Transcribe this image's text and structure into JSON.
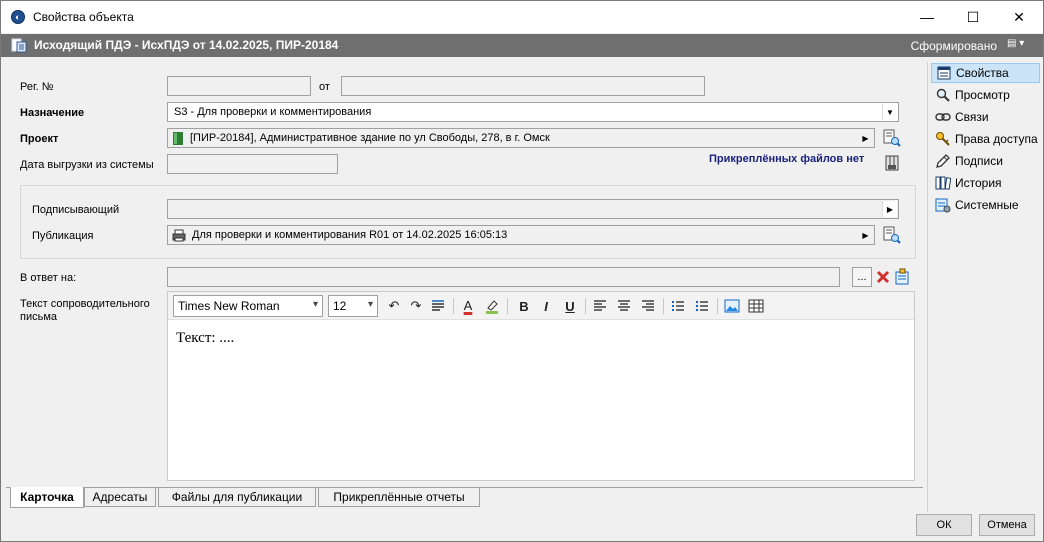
{
  "window": {
    "title": "Свойства объекта",
    "minimize_glyph": "—",
    "maximize_glyph": "☐",
    "close_glyph": "✕"
  },
  "header": {
    "title": "Исходящий ПДЭ - ИсхПДЭ от 14.02.2025, ПИР-20184",
    "status": "Сформировано",
    "menu_glyph": "▤ ▾"
  },
  "form": {
    "reg_no_label": "Рег. №",
    "reg_no_value": "",
    "from_label": "от",
    "from_value": "",
    "purpose_label": "Назначение",
    "purpose_value": "S3 - Для проверки и комментирования",
    "project_label": "Проект",
    "project_value": "[ПИР-20184], Административное здание по ул Свободы, 278, в г. Омск",
    "export_date_label": "Дата выгрузки из системы",
    "export_date_value": "",
    "attached_files_text": "Прикреплённых файлов нет",
    "signer_label": "Подписывающий",
    "signer_value": "",
    "publication_label": "Публикация",
    "publication_value": "Для проверки и комментирования R01 от 14.02.2025 16:05:13",
    "in_reply_label": "В ответ на:",
    "in_reply_value": "",
    "in_reply_browse": "...",
    "cover_letter_label": "Текст сопроводительного письма"
  },
  "editor": {
    "font": "Times New Roman",
    "size": "12",
    "body_text": "Текст: ....",
    "bold_glyph": "B",
    "italic_glyph": "I",
    "underline_glyph": "U",
    "font_color_glyph": "A"
  },
  "tabs": [
    {
      "label": "Карточка",
      "active": true
    },
    {
      "label": "Адресаты",
      "active": false
    },
    {
      "label": "Файлы для публикации",
      "active": false
    },
    {
      "label": "Прикреплённые отчеты",
      "active": false
    }
  ],
  "sidebar": {
    "items": [
      {
        "label": "Свойства",
        "icon": "properties-icon",
        "selected": true
      },
      {
        "label": "Просмотр",
        "icon": "magnifier-icon",
        "selected": false
      },
      {
        "label": "Связи",
        "icon": "link-icon",
        "selected": false
      },
      {
        "label": "Права доступа",
        "icon": "key-icon",
        "selected": false
      },
      {
        "label": "Подписи",
        "icon": "pen-icon",
        "selected": false
      },
      {
        "label": "История",
        "icon": "books-icon",
        "selected": false
      },
      {
        "label": "Системные",
        "icon": "system-icon",
        "selected": false
      }
    ]
  },
  "buttons": {
    "ok": "ОК",
    "cancel": "Отмена"
  },
  "colors": {
    "header_bg": "#6f6f6f",
    "selection_bg": "#cce4f7",
    "attached_text": "#1a237e",
    "delete_red": "#d32f2f"
  }
}
